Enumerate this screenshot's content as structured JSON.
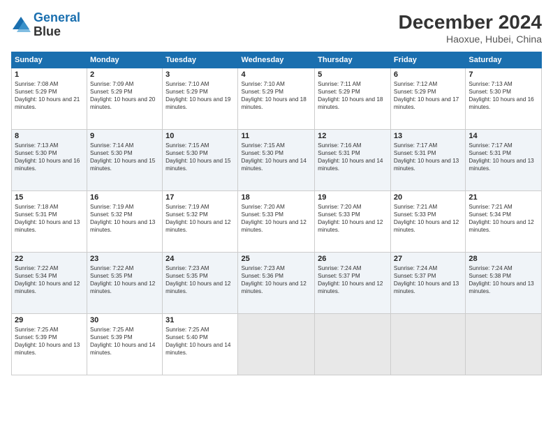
{
  "logo": {
    "line1": "General",
    "line2": "Blue"
  },
  "title": "December 2024",
  "location": "Haoxue, Hubei, China",
  "weekdays": [
    "Sunday",
    "Monday",
    "Tuesday",
    "Wednesday",
    "Thursday",
    "Friday",
    "Saturday"
  ],
  "weeks": [
    [
      {
        "day": "1",
        "sunrise": "7:08 AM",
        "sunset": "5:29 PM",
        "daylight": "10 hours and 21 minutes."
      },
      {
        "day": "2",
        "sunrise": "7:09 AM",
        "sunset": "5:29 PM",
        "daylight": "10 hours and 20 minutes."
      },
      {
        "day": "3",
        "sunrise": "7:10 AM",
        "sunset": "5:29 PM",
        "daylight": "10 hours and 19 minutes."
      },
      {
        "day": "4",
        "sunrise": "7:10 AM",
        "sunset": "5:29 PM",
        "daylight": "10 hours and 18 minutes."
      },
      {
        "day": "5",
        "sunrise": "7:11 AM",
        "sunset": "5:29 PM",
        "daylight": "10 hours and 18 minutes."
      },
      {
        "day": "6",
        "sunrise": "7:12 AM",
        "sunset": "5:29 PM",
        "daylight": "10 hours and 17 minutes."
      },
      {
        "day": "7",
        "sunrise": "7:13 AM",
        "sunset": "5:30 PM",
        "daylight": "10 hours and 16 minutes."
      }
    ],
    [
      {
        "day": "8",
        "sunrise": "7:13 AM",
        "sunset": "5:30 PM",
        "daylight": "10 hours and 16 minutes."
      },
      {
        "day": "9",
        "sunrise": "7:14 AM",
        "sunset": "5:30 PM",
        "daylight": "10 hours and 15 minutes."
      },
      {
        "day": "10",
        "sunrise": "7:15 AM",
        "sunset": "5:30 PM",
        "daylight": "10 hours and 15 minutes."
      },
      {
        "day": "11",
        "sunrise": "7:15 AM",
        "sunset": "5:30 PM",
        "daylight": "10 hours and 14 minutes."
      },
      {
        "day": "12",
        "sunrise": "7:16 AM",
        "sunset": "5:31 PM",
        "daylight": "10 hours and 14 minutes."
      },
      {
        "day": "13",
        "sunrise": "7:17 AM",
        "sunset": "5:31 PM",
        "daylight": "10 hours and 13 minutes."
      },
      {
        "day": "14",
        "sunrise": "7:17 AM",
        "sunset": "5:31 PM",
        "daylight": "10 hours and 13 minutes."
      }
    ],
    [
      {
        "day": "15",
        "sunrise": "7:18 AM",
        "sunset": "5:31 PM",
        "daylight": "10 hours and 13 minutes."
      },
      {
        "day": "16",
        "sunrise": "7:19 AM",
        "sunset": "5:32 PM",
        "daylight": "10 hours and 13 minutes."
      },
      {
        "day": "17",
        "sunrise": "7:19 AM",
        "sunset": "5:32 PM",
        "daylight": "10 hours and 12 minutes."
      },
      {
        "day": "18",
        "sunrise": "7:20 AM",
        "sunset": "5:33 PM",
        "daylight": "10 hours and 12 minutes."
      },
      {
        "day": "19",
        "sunrise": "7:20 AM",
        "sunset": "5:33 PM",
        "daylight": "10 hours and 12 minutes."
      },
      {
        "day": "20",
        "sunrise": "7:21 AM",
        "sunset": "5:33 PM",
        "daylight": "10 hours and 12 minutes."
      },
      {
        "day": "21",
        "sunrise": "7:21 AM",
        "sunset": "5:34 PM",
        "daylight": "10 hours and 12 minutes."
      }
    ],
    [
      {
        "day": "22",
        "sunrise": "7:22 AM",
        "sunset": "5:34 PM",
        "daylight": "10 hours and 12 minutes."
      },
      {
        "day": "23",
        "sunrise": "7:22 AM",
        "sunset": "5:35 PM",
        "daylight": "10 hours and 12 minutes."
      },
      {
        "day": "24",
        "sunrise": "7:23 AM",
        "sunset": "5:35 PM",
        "daylight": "10 hours and 12 minutes."
      },
      {
        "day": "25",
        "sunrise": "7:23 AM",
        "sunset": "5:36 PM",
        "daylight": "10 hours and 12 minutes."
      },
      {
        "day": "26",
        "sunrise": "7:24 AM",
        "sunset": "5:37 PM",
        "daylight": "10 hours and 12 minutes."
      },
      {
        "day": "27",
        "sunrise": "7:24 AM",
        "sunset": "5:37 PM",
        "daylight": "10 hours and 13 minutes."
      },
      {
        "day": "28",
        "sunrise": "7:24 AM",
        "sunset": "5:38 PM",
        "daylight": "10 hours and 13 minutes."
      }
    ],
    [
      {
        "day": "29",
        "sunrise": "7:25 AM",
        "sunset": "5:39 PM",
        "daylight": "10 hours and 13 minutes."
      },
      {
        "day": "30",
        "sunrise": "7:25 AM",
        "sunset": "5:39 PM",
        "daylight": "10 hours and 14 minutes."
      },
      {
        "day": "31",
        "sunrise": "7:25 AM",
        "sunset": "5:40 PM",
        "daylight": "10 hours and 14 minutes."
      },
      null,
      null,
      null,
      null
    ]
  ],
  "labels": {
    "sunrise": "Sunrise:",
    "sunset": "Sunset:",
    "daylight": "Daylight: "
  }
}
